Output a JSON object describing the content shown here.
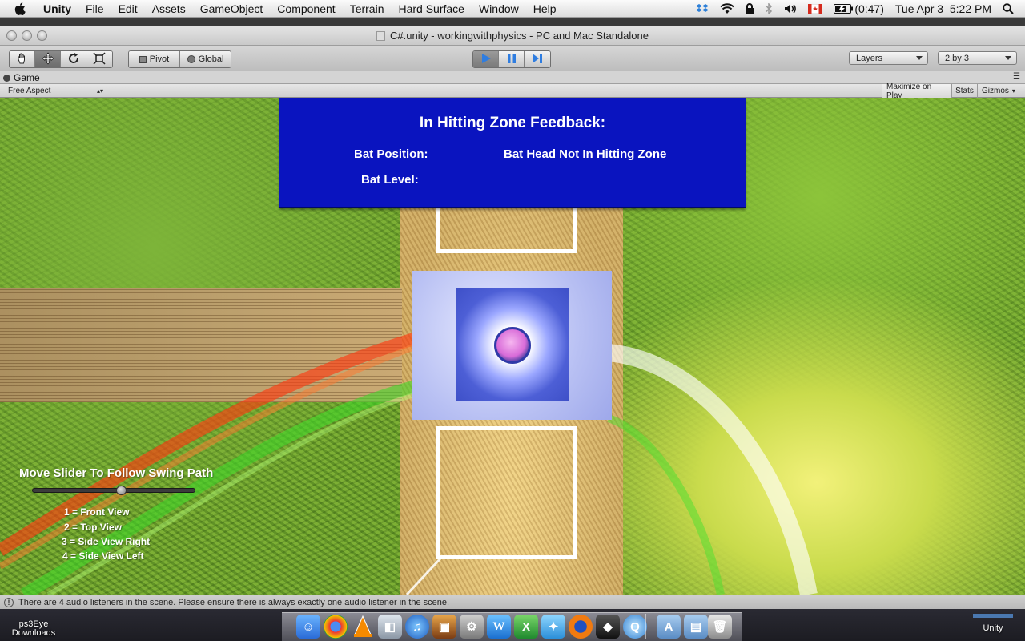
{
  "menubar": {
    "app_name": "Unity",
    "items": [
      "File",
      "Edit",
      "Assets",
      "GameObject",
      "Component",
      "Terrain",
      "Hard Surface",
      "Window",
      "Help"
    ],
    "battery": "(0:47)",
    "datetime": "Tue Apr 3  5:22 PM"
  },
  "window": {
    "title": "C#.unity - workingwithphysics - PC and Mac Standalone"
  },
  "toolbar": {
    "pivot_label": "Pivot",
    "global_label": "Global",
    "layers_label": "Layers",
    "layout_label": "2 by 3"
  },
  "game_panel": {
    "tab_label": "Game",
    "aspect_label": "Free Aspect",
    "maximize_label": "Maximize on Play",
    "stats_label": "Stats",
    "gizmos_label": "Gizmos"
  },
  "feedback": {
    "title": "In Hitting Zone Feedback:",
    "bat_position_label": "Bat Position:",
    "bat_position_value": "Bat Head Not In Hitting Zone",
    "bat_level_label": "Bat Level:"
  },
  "overlay": {
    "slider_instruction": "Move Slider To Follow Swing Path",
    "slider_value": 0.55,
    "views": [
      "1 = Front View",
      "2 = Top View",
      "3 = Side View Right",
      "4 = Side View Left"
    ]
  },
  "statusbar": {
    "message": "There are 4 audio listeners in the scene. Please ensure there is always exactly one audio listener in the scene."
  },
  "desktop": {
    "left_label_1": "ps3Eye",
    "left_label_2": "Downloads",
    "right_label": "Unity"
  },
  "colors": {
    "feedback_bg": "#0a14bf",
    "grass": "#6fa42e",
    "dirt": "#c9a55d",
    "zone": "#b8c0f3"
  }
}
